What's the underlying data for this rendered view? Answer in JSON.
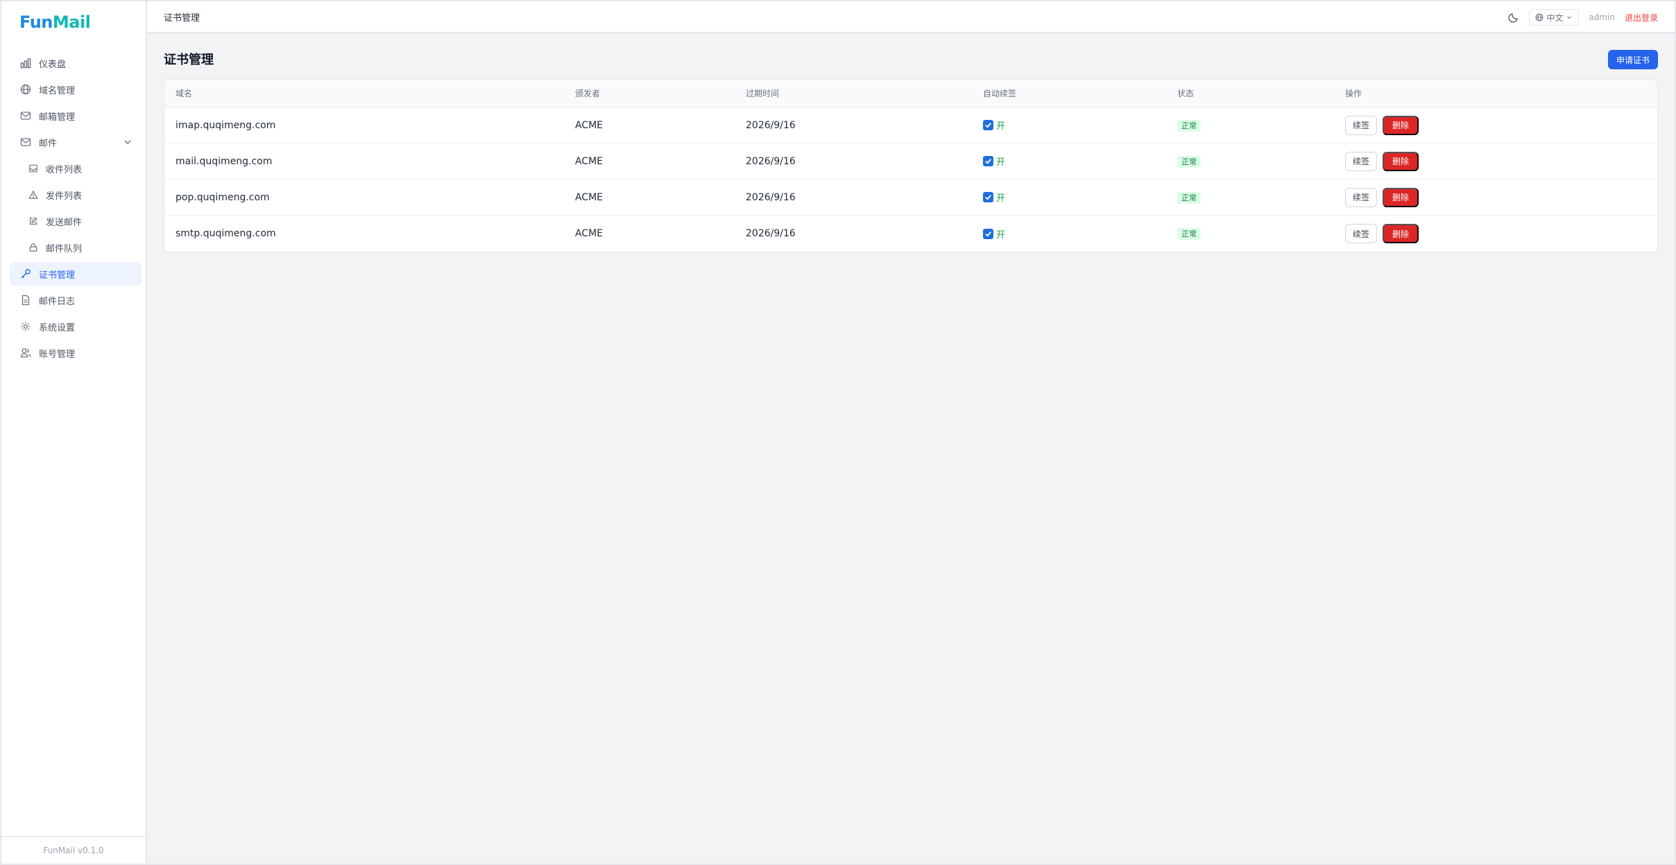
{
  "brand": {
    "part1": "Fun",
    "part2": "Mail"
  },
  "sidebar": {
    "items": [
      {
        "label": "仪表盘",
        "icon": "chart-icon"
      },
      {
        "label": "域名管理",
        "icon": "globe-icon"
      },
      {
        "label": "邮箱管理",
        "icon": "mail-icon"
      },
      {
        "label": "邮件",
        "icon": "mail-icon"
      },
      {
        "label": "收件列表",
        "icon": "inbox-icon"
      },
      {
        "label": "发件列表",
        "icon": "send-icon"
      },
      {
        "label": "发送邮件",
        "icon": "edit-icon"
      },
      {
        "label": "邮件队列",
        "icon": "queue-icon"
      },
      {
        "label": "证书管理",
        "icon": "key-icon"
      },
      {
        "label": "邮件日志",
        "icon": "file-icon"
      },
      {
        "label": "系统设置",
        "icon": "gear-icon"
      },
      {
        "label": "账号管理",
        "icon": "users-icon"
      }
    ],
    "footer": "FunMail v0.1.0"
  },
  "topbar": {
    "breadcrumb": "证书管理",
    "lang": "中文",
    "user": "admin",
    "logout": "退出登录"
  },
  "page": {
    "title": "证书管理",
    "apply_button": "申请证书"
  },
  "table": {
    "headers": [
      "域名",
      "颁发者",
      "过期时间",
      "自动续签",
      "状态",
      "操作"
    ],
    "rows": [
      {
        "domain": "imap.quqimeng.com",
        "issuer": "ACME",
        "expires": "2026/9/16",
        "auto": "开",
        "status": "正常",
        "renew": "续签",
        "delete": "删除"
      },
      {
        "domain": "mail.quqimeng.com",
        "issuer": "ACME",
        "expires": "2026/9/16",
        "auto": "开",
        "status": "正常",
        "renew": "续签",
        "delete": "删除"
      },
      {
        "domain": "pop.quqimeng.com",
        "issuer": "ACME",
        "expires": "2026/9/16",
        "auto": "开",
        "status": "正常",
        "renew": "续签",
        "delete": "删除"
      },
      {
        "domain": "smtp.quqimeng.com",
        "issuer": "ACME",
        "expires": "2026/9/16",
        "auto": "开",
        "status": "正常",
        "renew": "续签",
        "delete": "删除"
      }
    ]
  },
  "colors": {
    "accent": "#2563eb",
    "danger": "#dc2626",
    "success": "#15803d",
    "active_bg": "#eef4ff"
  }
}
